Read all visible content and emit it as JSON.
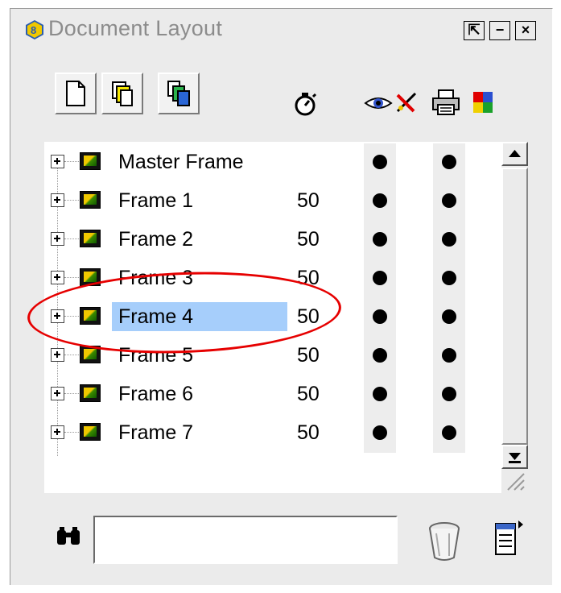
{
  "window": {
    "title": "Document Layout",
    "buttons": [
      "⇱",
      "−",
      "×"
    ]
  },
  "toolbar": {
    "buttons": [
      {
        "name": "new-frame-button",
        "icon": "new-page-icon"
      },
      {
        "name": "duplicate-frame-button",
        "icon": "duplicate-icon"
      },
      {
        "name": "copy-frame-button",
        "icon": "copy-pages-icon"
      }
    ],
    "column_icons": [
      "stopwatch-icon",
      "eye-icon",
      "lock-pencil-icon",
      "printer-icon",
      "color-icon"
    ]
  },
  "frames": [
    {
      "label": "Master Frame",
      "value": "",
      "visible": true,
      "print": true,
      "selected": false
    },
    {
      "label": "Frame 1",
      "value": "50",
      "visible": true,
      "print": true,
      "selected": false
    },
    {
      "label": "Frame 2",
      "value": "50",
      "visible": true,
      "print": true,
      "selected": false
    },
    {
      "label": "Frame 3",
      "value": "50",
      "visible": true,
      "print": true,
      "selected": false
    },
    {
      "label": "Frame 4",
      "value": "50",
      "visible": true,
      "print": true,
      "selected": true
    },
    {
      "label": "Frame 5",
      "value": "50",
      "visible": true,
      "print": true,
      "selected": false
    },
    {
      "label": "Frame 6",
      "value": "50",
      "visible": true,
      "print": true,
      "selected": false
    },
    {
      "label": "Frame 7",
      "value": "50",
      "visible": true,
      "print": true,
      "selected": false
    }
  ],
  "search": {
    "value": "",
    "placeholder": ""
  },
  "colors": {
    "selection": "#a6cefb",
    "highlight_ring": "#e60000",
    "panel": "#ebebeb"
  }
}
